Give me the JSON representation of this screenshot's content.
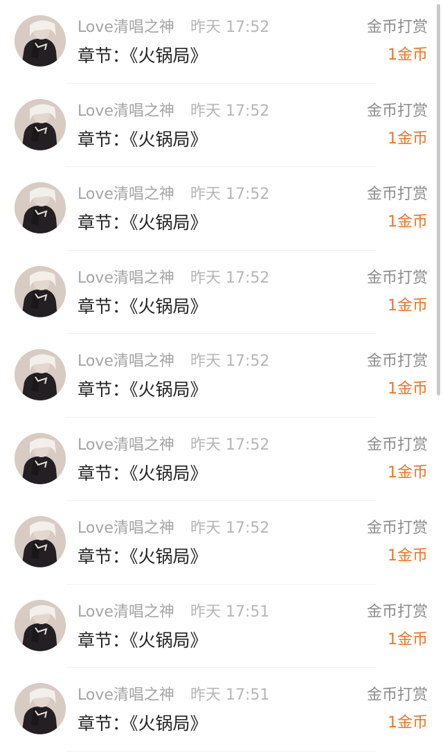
{
  "rewards": [
    {
      "user": "Love清唱之神",
      "time": "昨天 17:52",
      "chapter": "章节：《火锅局》",
      "gift_type": "金币打赏",
      "amount": "1金币"
    },
    {
      "user": "Love清唱之神",
      "time": "昨天 17:52",
      "chapter": "章节：《火锅局》",
      "gift_type": "金币打赏",
      "amount": "1金币"
    },
    {
      "user": "Love清唱之神",
      "time": "昨天 17:52",
      "chapter": "章节：《火锅局》",
      "gift_type": "金币打赏",
      "amount": "1金币"
    },
    {
      "user": "Love清唱之神",
      "time": "昨天 17:52",
      "chapter": "章节：《火锅局》",
      "gift_type": "金币打赏",
      "amount": "1金币"
    },
    {
      "user": "Love清唱之神",
      "time": "昨天 17:52",
      "chapter": "章节：《火锅局》",
      "gift_type": "金币打赏",
      "amount": "1金币"
    },
    {
      "user": "Love清唱之神",
      "time": "昨天 17:52",
      "chapter": "章节：《火锅局》",
      "gift_type": "金币打赏",
      "amount": "1金币"
    },
    {
      "user": "Love清唱之神",
      "time": "昨天 17:52",
      "chapter": "章节：《火锅局》",
      "gift_type": "金币打赏",
      "amount": "1金币"
    },
    {
      "user": "Love清唱之神",
      "time": "昨天 17:51",
      "chapter": "章节：《火锅局》",
      "gift_type": "金币打赏",
      "amount": "1金币"
    },
    {
      "user": "Love清唱之神",
      "time": "昨天 17:51",
      "chapter": "章节：《火锅局》",
      "gift_type": "金币打赏",
      "amount": "1金币"
    }
  ],
  "colors": {
    "accent": "#f2731f",
    "name_text": "#a4a4a4",
    "time_text": "#b6b6b6",
    "body_text": "#222222",
    "divider": "#f2f2f2"
  }
}
